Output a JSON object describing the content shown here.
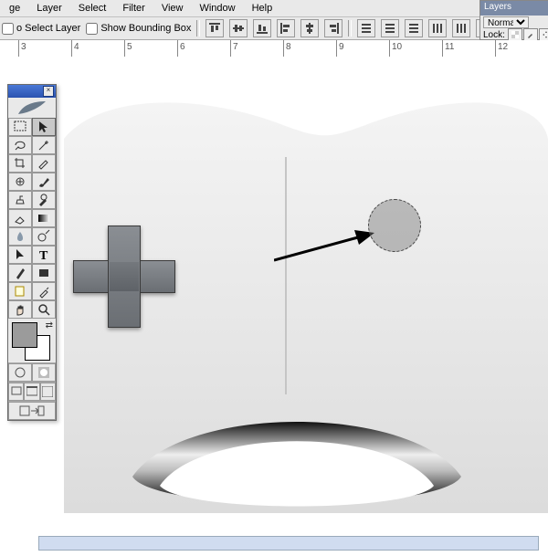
{
  "menu": {
    "items": [
      "ge",
      "Layer",
      "Select",
      "Filter",
      "View",
      "Window",
      "Help"
    ]
  },
  "options": {
    "autoSelectLabel": "o Select Layer",
    "showBoundingBox": "Show Bounding Box"
  },
  "ruler": {
    "marks": [
      "3",
      "4",
      "5",
      "6",
      "7",
      "8",
      "9",
      "10",
      "11",
      "12"
    ]
  },
  "layers": {
    "tab": "Layers",
    "blendMode": "Normal",
    "lockLabel": "Lock:"
  },
  "toolbox": {
    "tools": [
      {
        "name": "marquee",
        "selected": false
      },
      {
        "name": "move",
        "selected": true
      },
      {
        "name": "lasso",
        "selected": false
      },
      {
        "name": "magic-wand",
        "selected": false
      },
      {
        "name": "crop",
        "selected": false
      },
      {
        "name": "slice",
        "selected": false
      },
      {
        "name": "healing-brush",
        "selected": false
      },
      {
        "name": "brush",
        "selected": false
      },
      {
        "name": "clone-stamp",
        "selected": false
      },
      {
        "name": "history-brush",
        "selected": false
      },
      {
        "name": "eraser",
        "selected": false
      },
      {
        "name": "gradient",
        "selected": false
      },
      {
        "name": "blur",
        "selected": false
      },
      {
        "name": "dodge",
        "selected": false
      },
      {
        "name": "path-select",
        "selected": false
      },
      {
        "name": "type",
        "selected": false
      },
      {
        "name": "pen",
        "selected": false
      },
      {
        "name": "shape",
        "selected": false
      },
      {
        "name": "notes",
        "selected": false
      },
      {
        "name": "eyedropper",
        "selected": false
      },
      {
        "name": "hand",
        "selected": false
      },
      {
        "name": "zoom",
        "selected": false
      }
    ],
    "closeGlyph": "×"
  }
}
